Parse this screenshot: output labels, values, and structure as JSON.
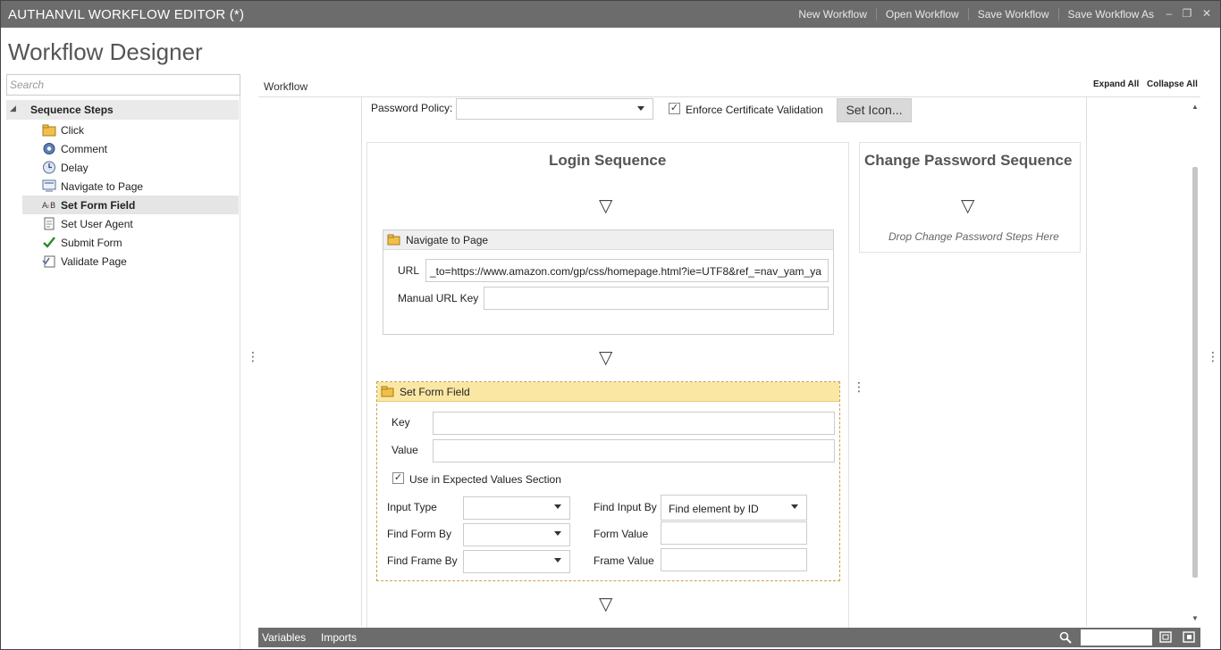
{
  "window": {
    "title": "AUTHANVIL WORKFLOW EDITOR (*)",
    "menu": [
      "New Workflow",
      "Open Workflow",
      "Save Workflow",
      "Save Workflow As"
    ],
    "controls": {
      "minimize": "–",
      "restore": "❐",
      "close": "✕"
    }
  },
  "app_title": "Workflow Designer",
  "sidebar": {
    "search_placeholder": "Search",
    "root": "Sequence Steps",
    "items": [
      {
        "label": "Click",
        "icon": "folder-icon"
      },
      {
        "label": "Comment",
        "icon": "gear-icon"
      },
      {
        "label": "Delay",
        "icon": "clock-icon"
      },
      {
        "label": "Navigate to Page",
        "icon": "navigate-icon"
      },
      {
        "label": "Set Form Field",
        "icon": "ab-text-icon",
        "selected": true
      },
      {
        "label": "Set User Agent",
        "icon": "document-icon"
      },
      {
        "label": "Submit Form",
        "icon": "checkmark-icon"
      },
      {
        "label": "Validate Page",
        "icon": "validate-icon"
      }
    ]
  },
  "workspace": {
    "header": "Workflow",
    "expand_all": "Expand All",
    "collapse_all": "Collapse All",
    "password_policy_label": "Password Policy:",
    "password_policy_value": "",
    "enforce_label": "Enforce Certificate Validation",
    "enforce_checked": true,
    "set_icon_label": "Set Icon...",
    "login_sequence": {
      "title": "Login Sequence",
      "navigate": {
        "title": "Navigate to Page",
        "url_label": "URL",
        "url_value": "_to=https://www.amazon.com/gp/css/homepage.html?ie=UTF8&ref_=nav_yam_ya",
        "manual_label": "Manual URL Key",
        "manual_value": ""
      },
      "set_form_field": {
        "title": "Set Form Field",
        "key_label": "Key",
        "key_value": "",
        "value_label": "Value",
        "value_value": "",
        "use_expected_label": "Use in Expected Values Section",
        "use_expected_checked": true,
        "input_type_label": "Input Type",
        "find_form_label": "Find Form By",
        "find_frame_label": "Find Frame By",
        "find_input_label": "Find Input By",
        "find_input_value": "Find element by ID",
        "form_value_label": "Form Value",
        "frame_value_label": "Frame Value"
      }
    },
    "change_password_sequence": {
      "title": "Change Password Sequence",
      "drop_hint": "Drop Change Password Steps Here"
    }
  },
  "bottom_bar": {
    "tabs": [
      "Variables",
      "Imports"
    ]
  },
  "colors": {
    "titlebar": "#6c6c6c",
    "selected_activity": "#fbe7a4"
  }
}
